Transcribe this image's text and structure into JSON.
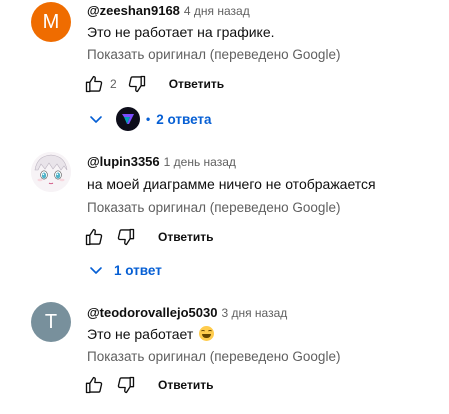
{
  "comments": [
    {
      "avatar_letter": "M",
      "avatar_color": "#ef6c00",
      "author": "@zeeshan9168",
      "time": "4 дня назад",
      "text": "Это не работает на графике.",
      "translate": "Показать оригинал (переведено Google)",
      "likes": "2",
      "reply_label": "Ответить",
      "replies_label": "2 ответа"
    },
    {
      "author": "@lupin3356",
      "time": "1 день назад",
      "text": "на моей диаграмме ничего не отображается",
      "translate": "Показать оригинал (переведено Google)",
      "reply_label": "Ответить",
      "replies_label": "1 ответ"
    },
    {
      "avatar_letter": "T",
      "avatar_color": "#78909c",
      "author": "@teodorovallejo5030",
      "time": "3 дня назад",
      "text": "Это не работает",
      "translate": "Показать оригинал (переведено Google)",
      "reply_label": "Ответить"
    }
  ],
  "icons": {
    "like": "thumbs-up-icon",
    "dislike": "thumbs-down-icon",
    "expand": "chevron-down-icon",
    "emoji": "grinning-face-with-sweat-icon"
  },
  "colors": {
    "link_blue": "#065fd4",
    "secondary_text": "#606060"
  }
}
